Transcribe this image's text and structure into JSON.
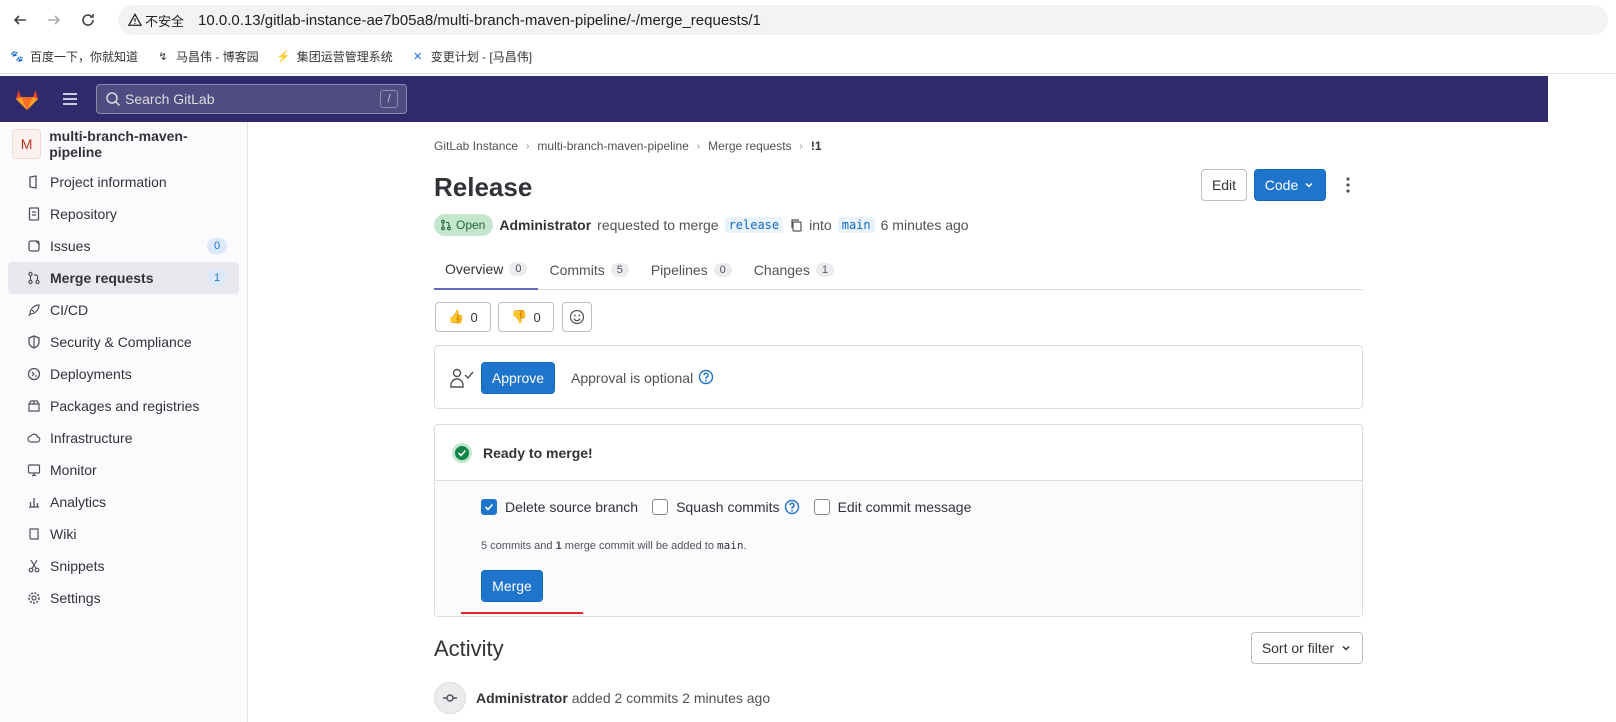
{
  "browser": {
    "security_label": "不安全",
    "url": "10.0.0.13/gitlab-instance-ae7b05a8/multi-branch-maven-pipeline/-/merge_requests/1",
    "bookmarks": [
      {
        "label": "百度一下，你就知道",
        "icon": "baidu-icon"
      },
      {
        "label": "马昌伟 - 博客园",
        "icon": "cnblogs-icon"
      },
      {
        "label": "集团运营管理系统",
        "icon": "fire-icon"
      },
      {
        "label": "变更计划 - [马昌伟]",
        "icon": "confluence-icon"
      }
    ]
  },
  "topbar": {
    "search_placeholder": "Search GitLab",
    "search_shortcut": "/"
  },
  "sidebar": {
    "project_initial": "M",
    "project_name": "multi-branch-maven-pipeline",
    "items": [
      {
        "label": "Project information",
        "icon": "info-icon"
      },
      {
        "label": "Repository",
        "icon": "doc-icon"
      },
      {
        "label": "Issues",
        "icon": "issues-icon",
        "count": "0"
      },
      {
        "label": "Merge requests",
        "icon": "merge-request-icon",
        "count": "1"
      },
      {
        "label": "CI/CD",
        "icon": "rocket-icon"
      },
      {
        "label": "Security & Compliance",
        "icon": "shield-icon"
      },
      {
        "label": "Deployments",
        "icon": "deployments-icon"
      },
      {
        "label": "Packages and registries",
        "icon": "package-icon"
      },
      {
        "label": "Infrastructure",
        "icon": "cloud-icon"
      },
      {
        "label": "Monitor",
        "icon": "monitor-icon"
      },
      {
        "label": "Analytics",
        "icon": "chart-icon"
      },
      {
        "label": "Wiki",
        "icon": "book-icon"
      },
      {
        "label": "Snippets",
        "icon": "snippet-icon"
      },
      {
        "label": "Settings",
        "icon": "settings-icon"
      }
    ]
  },
  "breadcrumb": [
    "GitLab Instance",
    "multi-branch-maven-pipeline",
    "Merge requests",
    "!1"
  ],
  "mr": {
    "title": "Release",
    "edit_label": "Edit",
    "code_label": "Code",
    "status": "Open",
    "author": "Administrator",
    "requested_text": "requested to merge",
    "source_branch": "release",
    "into_text": "into",
    "target_branch": "main",
    "time_ago": "6 minutes ago"
  },
  "tabs": [
    {
      "label": "Overview",
      "count": "0"
    },
    {
      "label": "Commits",
      "count": "5"
    },
    {
      "label": "Pipelines",
      "count": "0"
    },
    {
      "label": "Changes",
      "count": "1"
    }
  ],
  "reactions": {
    "thumbs_up": "0",
    "thumbs_down": "0"
  },
  "approval": {
    "approve_label": "Approve",
    "optional_text": "Approval is optional"
  },
  "merge": {
    "ready_text": "Ready to merge!",
    "delete_source_label": "Delete source branch",
    "squash_label": "Squash commits",
    "edit_message_label": "Edit commit message",
    "info_prefix": "5 commits and ",
    "info_bold": "1",
    "info_mid": " merge commit will be added to ",
    "info_branch": "main",
    "info_suffix": ".",
    "merge_label": "Merge"
  },
  "activity": {
    "title": "Activity",
    "sort_label": "Sort or filter",
    "first_author": "Administrator",
    "first_text": "added 2 commits 2 minutes ago"
  },
  "colors": {
    "topbar": "#2f2a6b",
    "primary": "#1f75cb",
    "open_badge_bg": "#c3e6cd",
    "success": "#108548",
    "highlight_underline": "#e22a2a"
  }
}
